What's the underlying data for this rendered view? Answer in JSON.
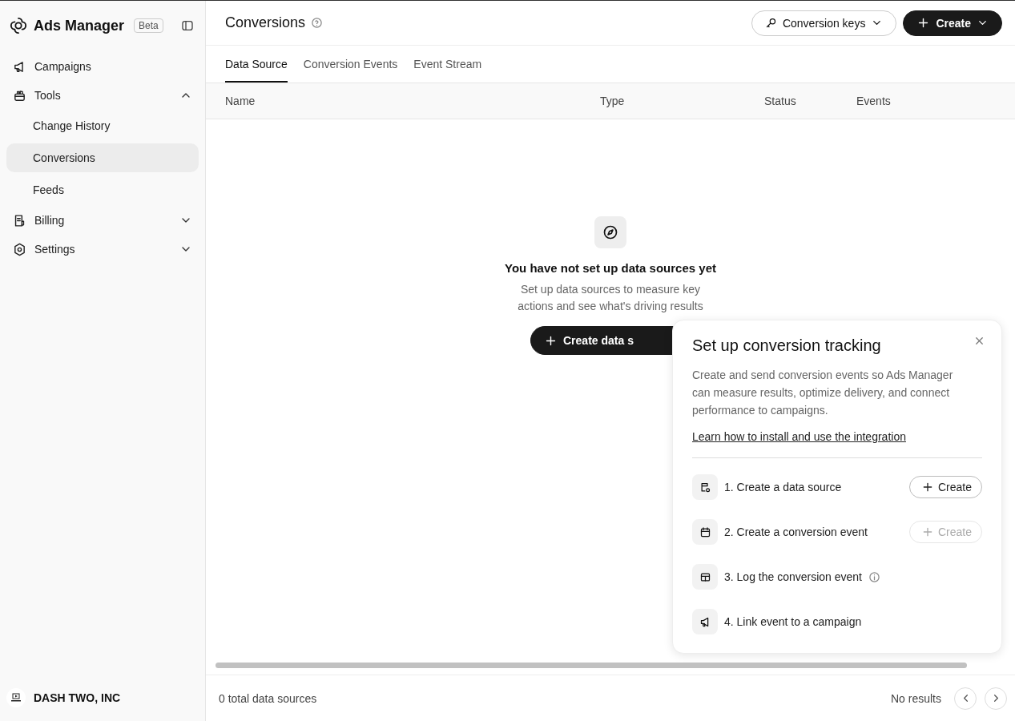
{
  "sidebar": {
    "app_name": "Ads Manager",
    "badge": "Beta",
    "items": [
      {
        "label": "Campaigns",
        "selected": false
      },
      {
        "label": "Tools",
        "selected": false,
        "expanded": true,
        "children": [
          {
            "label": "Change History",
            "selected": false
          },
          {
            "label": "Conversions",
            "selected": true
          },
          {
            "label": "Feeds",
            "selected": false
          }
        ]
      },
      {
        "label": "Billing",
        "selected": false,
        "expanded": false
      },
      {
        "label": "Settings",
        "selected": false,
        "expanded": false
      }
    ],
    "account": {
      "name": "DASH TWO, INC"
    }
  },
  "header": {
    "title": "Conversions",
    "keys_button": "Conversion keys",
    "create_button": "Create"
  },
  "tabs": [
    {
      "label": "Data Source",
      "selected": true
    },
    {
      "label": "Conversion Events",
      "selected": false
    },
    {
      "label": "Event Stream",
      "selected": false
    }
  ],
  "table": {
    "columns": [
      "Name",
      "Type",
      "Status",
      "Events"
    ]
  },
  "empty_state": {
    "title": "You have not set up data sources yet",
    "text": "Set up data sources to measure key actions and see what's driving results",
    "button": "Create data s"
  },
  "footer": {
    "count": "0 total data sources",
    "results": "No results"
  },
  "panel": {
    "title": "Set up conversion tracking",
    "text": "Create and send conversion events so Ads Manager can measure results, optimize delivery, and connect performance to campaigns.",
    "link": "Learn how to install and use the integration",
    "steps": [
      {
        "label": "1. Create a data source",
        "info": false,
        "action": {
          "label": "Create",
          "disabled": false
        }
      },
      {
        "label": "2. Create a conversion event",
        "info": false,
        "action": {
          "label": "Create",
          "disabled": true
        }
      },
      {
        "label": "3. Log the conversion event",
        "info": true
      },
      {
        "label": "4. Link event to a campaign",
        "info": false
      }
    ]
  }
}
